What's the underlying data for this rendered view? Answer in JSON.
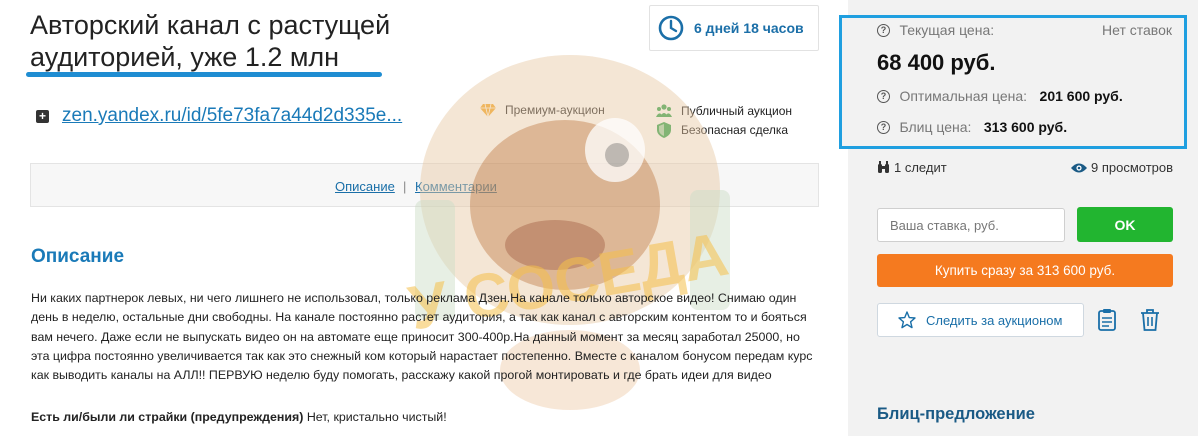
{
  "lot": {
    "title": "Авторский канал с растущей аудиторией, уже 1.2 млн",
    "timer": "6 дней 18 часов",
    "link": "zen.yandex.ru/id/5fe73fa7a44d2d335e...",
    "badges": {
      "premium": "Премиум-аукцион",
      "public": "Публичный аукцион",
      "safe": "Безопасная сделка"
    }
  },
  "tabs": [
    "Описание",
    "Комментарии"
  ],
  "description": {
    "heading": "Описание",
    "text": "Ни каких партнерок левых, ни чего лишнего не использовал, только реклама Дзен.На канале только авторское видео! Снимаю один день в неделю, остальные дни свободны. На канале постоянно растет аудитория, а так как канал с авторским контентом то и бояться вам нечего. Даже если не выпускать видео он на автомате еще приносит 300-400р.На данный момент за месяц заработал 25000, но эта цифра постоянно увеличивается так как это снежный ком который нарастает постепенно. Вместе с каналом бонусом передам курс как выводить каналы на АЛЛ!! ПЕРВУЮ неделю буду помогать, расскажу какой прогой монтировать и где брать идеи для видео",
    "strikes_label": "Есть ли/были ли страйки (предупреждения)",
    "strikes_value": "Нет, кристально чистый!"
  },
  "pricing": {
    "current_label": "Текущая цена:",
    "no_bids": "Нет ставок",
    "current_value": "68 400 руб.",
    "optimal_label": "Оптимальная цена:",
    "optimal_value": "201 600 руб.",
    "blitz_label": "Блиц цена:",
    "blitz_value": "313 600 руб."
  },
  "stats": {
    "watching": "1 следит",
    "views": "9 просмотров"
  },
  "bid": {
    "placeholder": "Ваша ставка, руб.",
    "ok_label": "OK",
    "buy_label": "Купить сразу за 313 600 руб.",
    "follow_label": "Следить за аукционом"
  },
  "blitz_section": {
    "title": "Блиц-предложение"
  },
  "watermark_text": "У СОСЕДА",
  "colors": {
    "accent": "#1f9fe0",
    "link": "#1a7ab8",
    "ok": "#22b530",
    "buy": "#f57a1f"
  }
}
